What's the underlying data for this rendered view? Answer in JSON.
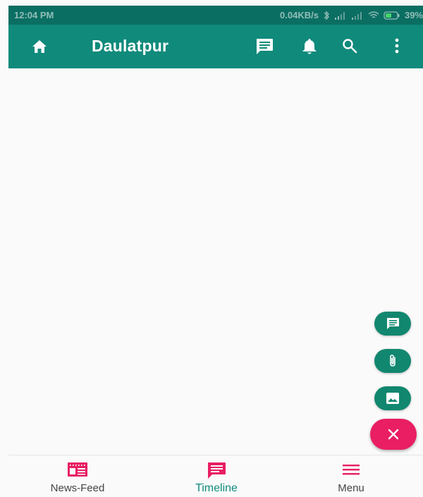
{
  "status_bar": {
    "time": "12:04 PM",
    "net_speed": "0.04KB/s",
    "battery": "39%"
  },
  "app_bar": {
    "title": "Daulatpur",
    "icons": [
      "home-icon",
      "message-icon",
      "bell-icon",
      "search-icon",
      "more-vert-icon"
    ]
  },
  "fab": {
    "actions": [
      "message-icon",
      "attach-icon",
      "image-icon"
    ],
    "main_icon": "close-icon"
  },
  "bottom_nav": {
    "items": [
      {
        "label": "News-Feed",
        "icon": "newsfeed-icon"
      },
      {
        "label": "Timeline",
        "icon": "message-icon"
      },
      {
        "label": "Menu",
        "icon": "menu-icon"
      }
    ],
    "active": "Timeline"
  },
  "colors": {
    "primary": "#0f8a7b",
    "status": "#0b6e62",
    "accent": "#e91e63",
    "background": "#fafafa"
  }
}
